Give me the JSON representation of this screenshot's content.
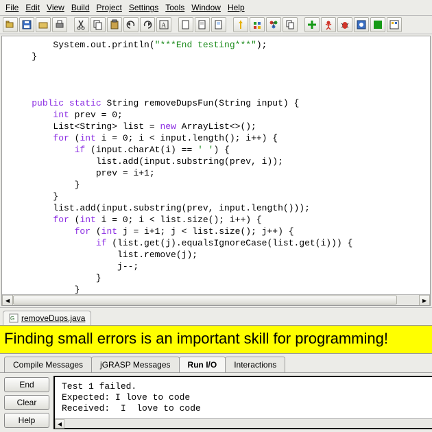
{
  "menu": {
    "file": "File",
    "edit": "Edit",
    "view": "View",
    "build": "Build",
    "project": "Project",
    "settings": "Settings",
    "tools": "Tools",
    "window": "Window",
    "help": "Help"
  },
  "toolbar_icons": {
    "open": "open-icon",
    "save": "save-icon",
    "browse": "browse-icon",
    "print": "print-icon",
    "cut": "cut-icon",
    "copy": "copy-icon",
    "paste": "paste-icon",
    "undo": "undo-icon",
    "redo": "redo-icon",
    "selectall": "selectall-icon",
    "newfile": "newfile-icon",
    "compile": "compile-icon",
    "compileproj": "compileproj-icon",
    "uml": "uml-icon",
    "csd": "csd-icon",
    "cpg": "cpg-icon",
    "doc": "doc-icon",
    "runplus": "runplus-icon",
    "run": "run-icon",
    "debug": "debug-icon",
    "viewer": "viewer-icon",
    "canvas": "canvas-icon",
    "interactions": "interactions-icon"
  },
  "code": {
    "l1_a": "        System.out.println(",
    "l1_s": "\"***End testing***\"",
    "l1_b": ");",
    "l2": "    }",
    "blank": "",
    "l3_a": "    ",
    "l3_kw1": "public static",
    "l3_b": " String removeDupsFun(String input) {",
    "l4_a": "        ",
    "l4_kw1": "int",
    "l4_b": " prev = 0;",
    "l5_a": "        List<String> list = ",
    "l5_kw1": "new",
    "l5_b": " ArrayList<>();",
    "l6_a": "        ",
    "l6_kw1": "for",
    "l6_b": " (",
    "l6_kw2": "int",
    "l6_c": " i = 0; i < input.length(); i++) {",
    "l7_a": "            ",
    "l7_kw1": "if",
    "l7_b": " (input.charAt(i) == ",
    "l7_s": "' '",
    "l7_c": ") {",
    "l8": "                list.add(input.substring(prev, i));",
    "l9": "                prev = i+1;",
    "l10": "            }",
    "l11": "        }",
    "l12": "        list.add(input.substring(prev, input.length()));",
    "l13_a": "        ",
    "l13_kw1": "for",
    "l13_b": " (",
    "l13_kw2": "int",
    "l13_c": " i = 0; i < list.size(); i++) {",
    "l14_a": "            ",
    "l14_kw1": "for",
    "l14_b": " (",
    "l14_kw2": "int",
    "l14_c": " j = i+1; j < list.size(); j++) {",
    "l15_a": "                ",
    "l15_kw1": "if",
    "l15_b": " (list.get(j).equalsIgnoreCase(list.get(i))) {",
    "l16": "                    list.remove(j);",
    "l17": "                    j--;",
    "l18": "                }",
    "l19": "            }",
    "l20": "        }"
  },
  "file_tab": "removeDups.java",
  "banner": "Finding small errors is an important skill for programming!",
  "bottom_tabs": {
    "compile": "Compile Messages",
    "jgrasp": "jGRASP Messages",
    "runio": "Run I/O",
    "interactions": "Interactions"
  },
  "runio": {
    "end": "End",
    "clear": "Clear",
    "help": "Help",
    "line1": "Test 1 failed.",
    "line2": "Expected: I love to code",
    "line3": "Received:  I  love to code"
  }
}
